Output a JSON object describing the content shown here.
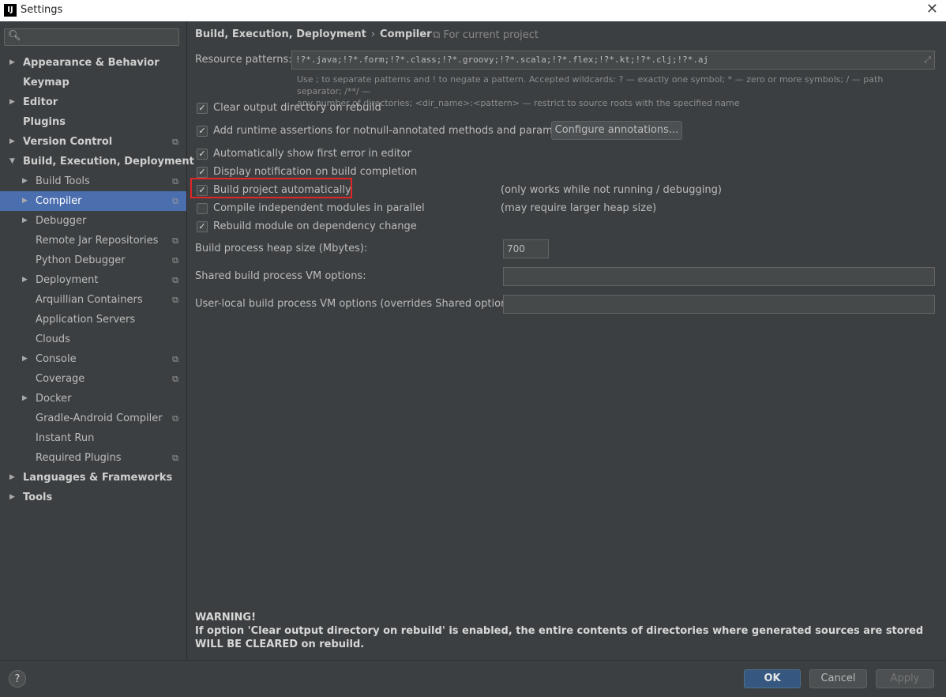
{
  "window": {
    "title": "Settings",
    "app_icon": "IJ"
  },
  "sidebar": {
    "search_placeholder": "",
    "items": [
      {
        "label": "Appearance & Behavior",
        "bold": true,
        "arrow": "right",
        "indent": 0,
        "project": false
      },
      {
        "label": "Keymap",
        "bold": true,
        "arrow": "",
        "indent": 0,
        "project": false
      },
      {
        "label": "Editor",
        "bold": true,
        "arrow": "right",
        "indent": 0,
        "project": false
      },
      {
        "label": "Plugins",
        "bold": true,
        "arrow": "",
        "indent": 0,
        "project": false
      },
      {
        "label": "Version Control",
        "bold": true,
        "arrow": "right",
        "indent": 0,
        "project": true
      },
      {
        "label": "Build, Execution, Deployment",
        "bold": true,
        "arrow": "down",
        "indent": 0,
        "project": false
      },
      {
        "label": "Build Tools",
        "bold": false,
        "arrow": "right",
        "indent": 1,
        "project": true
      },
      {
        "label": "Compiler",
        "bold": false,
        "arrow": "right",
        "indent": 1,
        "project": true,
        "selected": true
      },
      {
        "label": "Debugger",
        "bold": false,
        "arrow": "right",
        "indent": 1,
        "project": false
      },
      {
        "label": "Remote Jar Repositories",
        "bold": false,
        "arrow": "",
        "indent": 1,
        "project": true
      },
      {
        "label": "Python Debugger",
        "bold": false,
        "arrow": "",
        "indent": 1,
        "project": true
      },
      {
        "label": "Deployment",
        "bold": false,
        "arrow": "right",
        "indent": 1,
        "project": true
      },
      {
        "label": "Arquillian Containers",
        "bold": false,
        "arrow": "",
        "indent": 1,
        "project": true
      },
      {
        "label": "Application Servers",
        "bold": false,
        "arrow": "",
        "indent": 1,
        "project": false
      },
      {
        "label": "Clouds",
        "bold": false,
        "arrow": "",
        "indent": 1,
        "project": false
      },
      {
        "label": "Console",
        "bold": false,
        "arrow": "right",
        "indent": 1,
        "project": true
      },
      {
        "label": "Coverage",
        "bold": false,
        "arrow": "",
        "indent": 1,
        "project": true
      },
      {
        "label": "Docker",
        "bold": false,
        "arrow": "right",
        "indent": 1,
        "project": false
      },
      {
        "label": "Gradle-Android Compiler",
        "bold": false,
        "arrow": "",
        "indent": 1,
        "project": true
      },
      {
        "label": "Instant Run",
        "bold": false,
        "arrow": "",
        "indent": 1,
        "project": false
      },
      {
        "label": "Required Plugins",
        "bold": false,
        "arrow": "",
        "indent": 1,
        "project": true
      },
      {
        "label": "Languages & Frameworks",
        "bold": true,
        "arrow": "right",
        "indent": 0,
        "project": false
      },
      {
        "label": "Tools",
        "bold": true,
        "arrow": "right",
        "indent": 0,
        "project": false
      }
    ]
  },
  "main": {
    "breadcrumb": {
      "parent": "Build, Execution, Deployment",
      "separator": "›",
      "current": "Compiler"
    },
    "for_current_project": "For current project",
    "resource_patterns": {
      "label": "Resource patterns:",
      "value": "!?*.java;!?*.form;!?*.class;!?*.groovy;!?*.scala;!?*.flex;!?*.kt;!?*.clj;!?*.aj"
    },
    "hint_line1": "Use ; to separate patterns and ! to negate a pattern. Accepted wildcards: ? — exactly one symbol; * — zero or more symbols; / — path separator; /**/ —",
    "hint_line2": "any number of directories; <dir_name>:<pattern> — restrict to source roots with the specified name",
    "options": [
      {
        "label": "Clear output directory on rebuild",
        "checked": true,
        "note": ""
      },
      {
        "label": "Add runtime assertions for notnull-annotated methods and parameters",
        "checked": true,
        "note": ""
      },
      {
        "label": "Automatically show first error in editor",
        "checked": true,
        "note": ""
      },
      {
        "label": "Display notification on build completion",
        "checked": true,
        "note": ""
      },
      {
        "label": "Build project automatically",
        "checked": true,
        "note": "(only works while not running / debugging)"
      },
      {
        "label": "Compile independent modules in parallel",
        "checked": false,
        "note": "(may require larger heap size)"
      },
      {
        "label": "Rebuild module on dependency change",
        "checked": true,
        "note": ""
      }
    ],
    "configure_button": "Configure annotations...",
    "heap_size": {
      "label": "Build process heap size (Mbytes):",
      "value": "700"
    },
    "shared_vm": {
      "label": "Shared build process VM options:",
      "value": ""
    },
    "user_vm": {
      "label": "User-local build process VM options (overrides Shared options):",
      "value": ""
    },
    "warning_title": "WARNING!",
    "warning_text": "If option 'Clear output directory on rebuild' is enabled, the entire contents of directories where generated sources are stored WILL BE CLEARED on rebuild."
  },
  "footer": {
    "help": "?",
    "ok": "OK",
    "cancel": "Cancel",
    "apply": "Apply"
  },
  "colors": {
    "accent": "#4b6eaf",
    "highlight_box": "#e12626",
    "background": "#3c3f41"
  }
}
